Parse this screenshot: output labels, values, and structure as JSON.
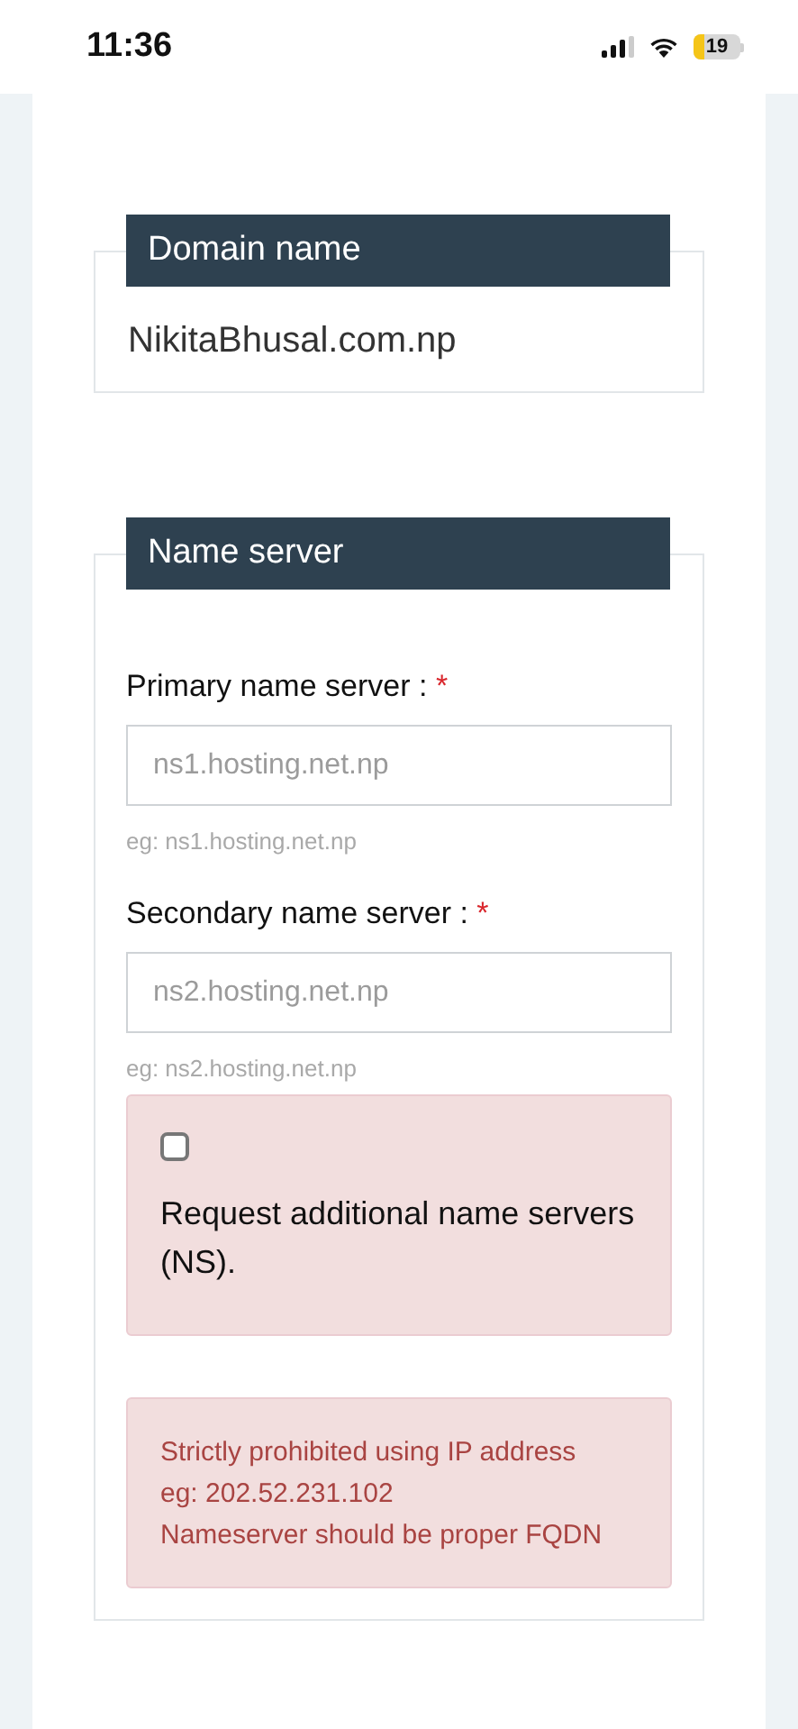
{
  "status_bar": {
    "time": "11:36",
    "battery": "19"
  },
  "domain_section": {
    "title": "Domain name",
    "value": "NikitaBhusal.com.np"
  },
  "name_server_section": {
    "title": "Name server",
    "fields": [
      {
        "label": "Primary name server :",
        "required_mark": "*",
        "placeholder": "ns1.hosting.net.np",
        "hint": "eg: ns1.hosting.net.np"
      },
      {
        "label": "Secondary name server :",
        "required_mark": "*",
        "placeholder": "ns2.hosting.net.np",
        "hint": "eg: ns2.hosting.net.np"
      }
    ],
    "additional_ns": {
      "checked": false,
      "label": "Request additional name servers (NS)."
    },
    "warning": [
      "Strictly prohibited using IP address",
      "eg: 202.52.231.102",
      "Nameserver should be proper FQDN"
    ]
  }
}
